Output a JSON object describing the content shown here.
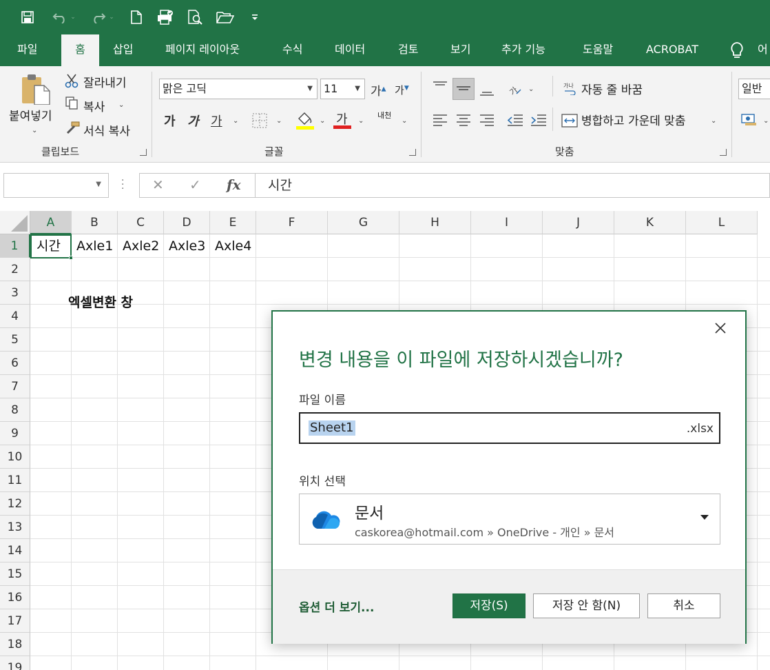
{
  "quick_access": {
    "save_icon": "save-icon",
    "undo_icon": "undo-icon",
    "redo_icon": "redo-icon",
    "new_icon": "new-document-icon",
    "print_icon": "print-icon",
    "preview_icon": "print-preview-icon",
    "open_icon": "open-folder-icon",
    "customize_icon": "customize-toolbar-icon"
  },
  "tabs": [
    "파일",
    "홈",
    "삽입",
    "페이지 레이아웃",
    "수식",
    "데이터",
    "검토",
    "보기",
    "추가 기능",
    "도움말",
    "ACROBAT",
    "어"
  ],
  "active_tab": "홈",
  "ribbon": {
    "clipboard": {
      "paste": "붙여넣기",
      "cut": "잘라내기",
      "copy": "복사",
      "format_painter": "서식 복사",
      "label": "클립보드"
    },
    "font": {
      "font_name": "맑은 고딕",
      "font_size": "11",
      "grow": "가",
      "shrink": "가",
      "bold": "가",
      "italic": "가",
      "underline": "가",
      "font_color": "가",
      "phonetic": "내천",
      "label": "글꼴"
    },
    "alignment": {
      "wrap": "자동 줄 바꿈",
      "merge": "병합하고 가운데 맞춤",
      "label": "맞춤"
    },
    "number": {
      "format": "일반"
    }
  },
  "formula_bar": {
    "name_box": "",
    "cancel": "✕",
    "enter": "✓",
    "fx": "fx",
    "content": "시간"
  },
  "grid": {
    "columns": [
      "A",
      "B",
      "C",
      "D",
      "E",
      "F",
      "G",
      "H",
      "I",
      "J",
      "K",
      "L"
    ],
    "rows": [
      "1",
      "2",
      "3",
      "4",
      "5",
      "6",
      "7",
      "8",
      "9",
      "10",
      "11",
      "12",
      "13",
      "14",
      "15",
      "16",
      "17",
      "18",
      "19"
    ],
    "cells": {
      "A1": "시간",
      "B1": "Axle1",
      "C1": "Axle2",
      "D1": "Axle3",
      "E1": "Axle4",
      "B3": "엑셀변환 창"
    }
  },
  "dialog": {
    "title": "변경 내용을 이 파일에 저장하시겠습니까?",
    "filename_label": "파일 이름",
    "filename": "Sheet1",
    "extension": ".xlsx",
    "location_label": "위치 선택",
    "location_name": "문서",
    "location_path": "caskorea@hotmail.com » OneDrive - 개인 » 문서",
    "more_options": "옵션 더 보기...",
    "save": "저장(S)",
    "dont_save": "저장 안 함(N)",
    "cancel": "취소"
  },
  "colors": {
    "excel_green": "#217346",
    "selection_blue": "#b8d3ef"
  }
}
